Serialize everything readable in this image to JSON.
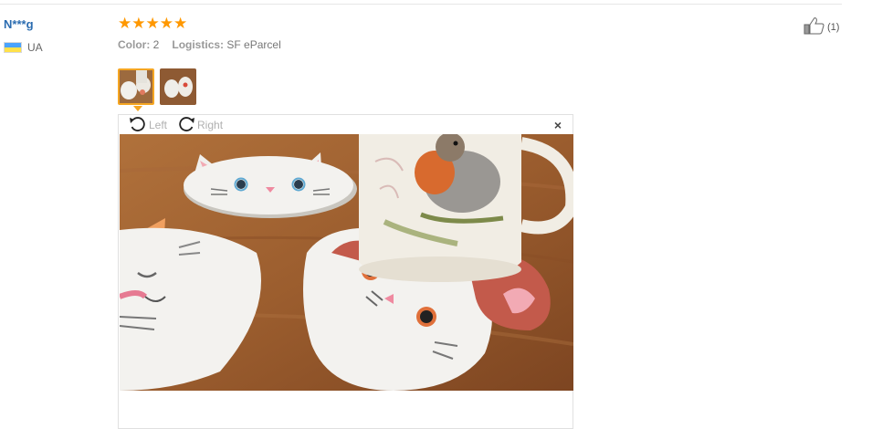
{
  "review": {
    "username": "N***g",
    "country_code": "UA",
    "rating": 5,
    "stars": "★★★★★",
    "color_label": "Color:",
    "color_value": "2",
    "logistics_label": "Logistics:",
    "logistics_value": "SF eParcel",
    "helpful_count": "(1)"
  },
  "viewer": {
    "rotate_left": "Left",
    "rotate_right": "Right",
    "close_glyph": "×"
  },
  "icons": {
    "thumbs_up": "thumbs-up-icon",
    "rotate_left": "rotate-left-icon",
    "rotate_right": "rotate-right-icon",
    "close": "close-icon",
    "flag": "ukraine-flag-icon"
  },
  "colors": {
    "username": "#2b6cb0",
    "stars": "#ff9800",
    "active_thumb_border": "#f5a623"
  }
}
